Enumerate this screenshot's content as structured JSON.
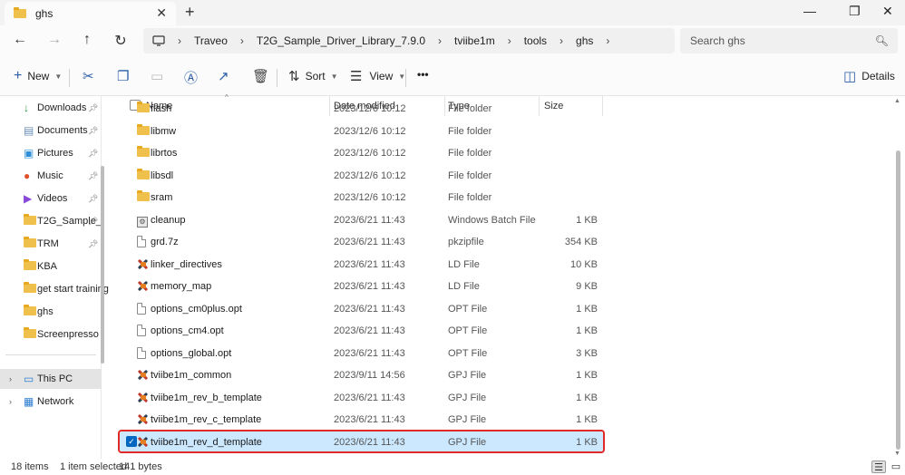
{
  "window": {
    "tab_title": "ghs",
    "tab_close": "✕",
    "tab_add": "+",
    "minimize": "—",
    "maximize": "❐",
    "close": "✕"
  },
  "nav": {
    "back": "←",
    "forward": "→",
    "up": "↑",
    "refresh": "↻",
    "breadcrumbs": [
      "Traveo",
      "T2G_Sample_Driver_Library_7.9.0",
      "tviibe1m",
      "tools",
      "ghs"
    ],
    "search_placeholder": "Search ghs"
  },
  "toolbar": {
    "new_label": "New",
    "sort_label": "Sort",
    "view_label": "View",
    "more_label": "•••",
    "details_label": "Details"
  },
  "sidebar": {
    "items": [
      {
        "label": "Downloads",
        "pinned": true,
        "icon": "download-icon"
      },
      {
        "label": "Documents",
        "pinned": true,
        "icon": "documents-icon"
      },
      {
        "label": "Pictures",
        "pinned": true,
        "icon": "pictures-icon"
      },
      {
        "label": "Music",
        "pinned": true,
        "icon": "music-icon"
      },
      {
        "label": "Videos",
        "pinned": true,
        "icon": "videos-icon"
      },
      {
        "label": "T2G_Sample_",
        "pinned": true,
        "icon": "folder-icon"
      },
      {
        "label": "TRM",
        "pinned": true,
        "icon": "folder-icon"
      },
      {
        "label": "KBA",
        "pinned": false,
        "icon": "folder-icon"
      },
      {
        "label": "get start training",
        "pinned": false,
        "icon": "folder-icon"
      },
      {
        "label": "ghs",
        "pinned": false,
        "icon": "folder-icon"
      },
      {
        "label": "Screenpresso",
        "pinned": false,
        "icon": "folder-icon"
      }
    ],
    "this_pc": "This PC",
    "network": "Network"
  },
  "columns": {
    "name": "Name",
    "date": "Date modified",
    "type": "Type",
    "size": "Size"
  },
  "files": [
    {
      "name": "flash",
      "date": "2023/12/6 10:12",
      "type": "File folder",
      "size": "",
      "icon": "folder"
    },
    {
      "name": "libmw",
      "date": "2023/12/6 10:12",
      "type": "File folder",
      "size": "",
      "icon": "folder"
    },
    {
      "name": "librtos",
      "date": "2023/12/6 10:12",
      "type": "File folder",
      "size": "",
      "icon": "folder"
    },
    {
      "name": "libsdl",
      "date": "2023/12/6 10:12",
      "type": "File folder",
      "size": "",
      "icon": "folder"
    },
    {
      "name": "sram",
      "date": "2023/12/6 10:12",
      "type": "File folder",
      "size": "",
      "icon": "folder"
    },
    {
      "name": "cleanup",
      "date": "2023/6/21 11:43",
      "type": "Windows Batch File",
      "size": "1 KB",
      "icon": "bat"
    },
    {
      "name": "grd.7z",
      "date": "2023/6/21 11:43",
      "type": "pkzipfile",
      "size": "354 KB",
      "icon": "file"
    },
    {
      "name": "linker_directives",
      "date": "2023/6/21 11:43",
      "type": "LD File",
      "size": "10 KB",
      "icon": "ghs"
    },
    {
      "name": "memory_map",
      "date": "2023/6/21 11:43",
      "type": "LD File",
      "size": "9 KB",
      "icon": "ghs"
    },
    {
      "name": "options_cm0plus.opt",
      "date": "2023/6/21 11:43",
      "type": "OPT File",
      "size": "1 KB",
      "icon": "file"
    },
    {
      "name": "options_cm4.opt",
      "date": "2023/6/21 11:43",
      "type": "OPT File",
      "size": "1 KB",
      "icon": "file"
    },
    {
      "name": "options_global.opt",
      "date": "2023/6/21 11:43",
      "type": "OPT File",
      "size": "3 KB",
      "icon": "file"
    },
    {
      "name": "tviibe1m_common",
      "date": "2023/9/11 14:56",
      "type": "GPJ File",
      "size": "1 KB",
      "icon": "ghs"
    },
    {
      "name": "tviibe1m_rev_b_template",
      "date": "2023/6/21 11:43",
      "type": "GPJ File",
      "size": "1 KB",
      "icon": "ghs"
    },
    {
      "name": "tviibe1m_rev_c_template",
      "date": "2023/6/21 11:43",
      "type": "GPJ File",
      "size": "1 KB",
      "icon": "ghs"
    },
    {
      "name": "tviibe1m_rev_d_template",
      "date": "2023/6/21 11:43",
      "type": "GPJ File",
      "size": "1 KB",
      "icon": "ghs",
      "selected": true
    }
  ],
  "status": {
    "items": "18 items",
    "selected": "1 item selected",
    "size": "141 bytes"
  },
  "colors": {
    "accent": "#0067c0",
    "selection": "#cce8ff",
    "highlight_outline": "#e02a2a",
    "folder": "#f0c04d"
  }
}
